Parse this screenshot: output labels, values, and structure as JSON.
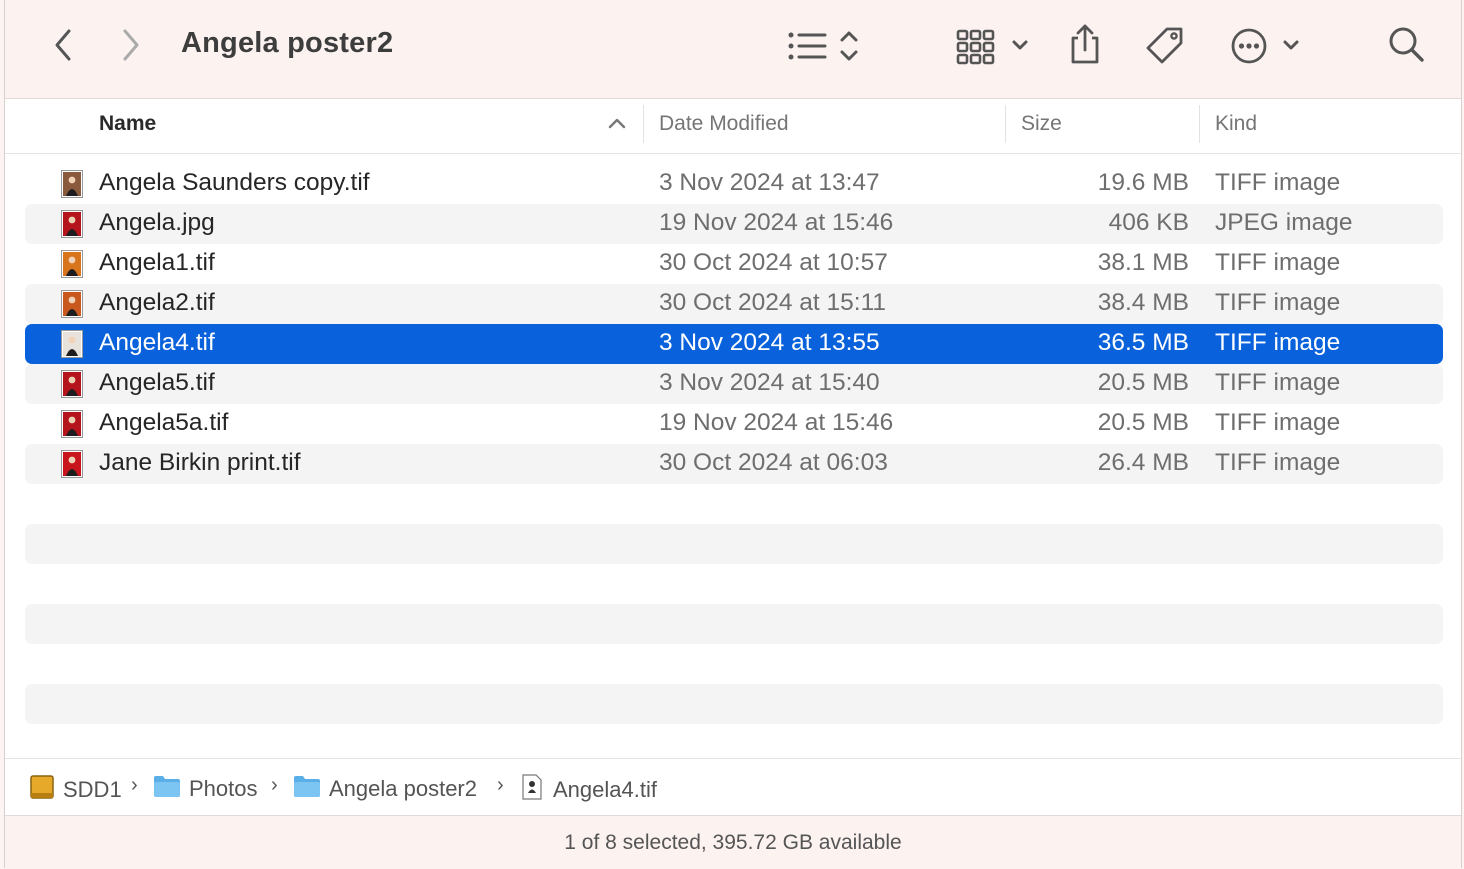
{
  "window": {
    "title": "Angela poster2"
  },
  "toolbar": {
    "icons": [
      "back-icon",
      "forward-icon",
      "list-view-icon",
      "grid-view-icon",
      "share-icon",
      "tag-icon",
      "more-icon",
      "search-icon"
    ]
  },
  "columns": {
    "name": "Name",
    "date": "Date Modified",
    "size": "Size",
    "kind": "Kind"
  },
  "files": [
    {
      "name": "Angela Saunders copy.tif",
      "date": "3 Nov 2024 at 13:47",
      "size": "19.6 MB",
      "kind": "TIFF image",
      "thumb": "#8a5a3c"
    },
    {
      "name": "Angela.jpg",
      "date": "19 Nov 2024 at 15:46",
      "size": "406 KB",
      "kind": "JPEG image",
      "thumb": "#b4141c"
    },
    {
      "name": "Angela1.tif",
      "date": "30 Oct 2024 at 10:57",
      "size": "38.1 MB",
      "kind": "TIFF image",
      "thumb": "#d8741c"
    },
    {
      "name": "Angela2.tif",
      "date": "30 Oct 2024 at 15:11",
      "size": "38.4 MB",
      "kind": "TIFF image",
      "thumb": "#c8581e"
    },
    {
      "name": "Angela4.tif",
      "date": "3 Nov 2024 at 13:55",
      "size": "36.5 MB",
      "kind": "TIFF image",
      "thumb": "#e8e2dc",
      "selected": true
    },
    {
      "name": "Angela5.tif",
      "date": "3 Nov 2024 at 15:40",
      "size": "20.5 MB",
      "kind": "TIFF image",
      "thumb": "#b4141c"
    },
    {
      "name": "Angela5a.tif",
      "date": "19 Nov 2024 at 15:46",
      "size": "20.5 MB",
      "kind": "TIFF image",
      "thumb": "#b4141c"
    },
    {
      "name": "Jane Birkin print.tif",
      "date": "30 Oct 2024 at 06:03",
      "size": "26.4 MB",
      "kind": "TIFF image",
      "thumb": "#c8141c"
    }
  ],
  "pathbar": [
    {
      "label": "SDD1",
      "icon": "drive-icon"
    },
    {
      "label": "Photos",
      "icon": "folder-icon"
    },
    {
      "label": "Angela poster2",
      "icon": "folder-icon"
    },
    {
      "label": "Angela4.tif",
      "icon": "tiff-file-icon"
    }
  ],
  "status": "1 of 8 selected, 395.72 GB available",
  "colors": {
    "selection": "#0962db",
    "folder": "#5aafe8",
    "drive": "#e6a92a"
  }
}
